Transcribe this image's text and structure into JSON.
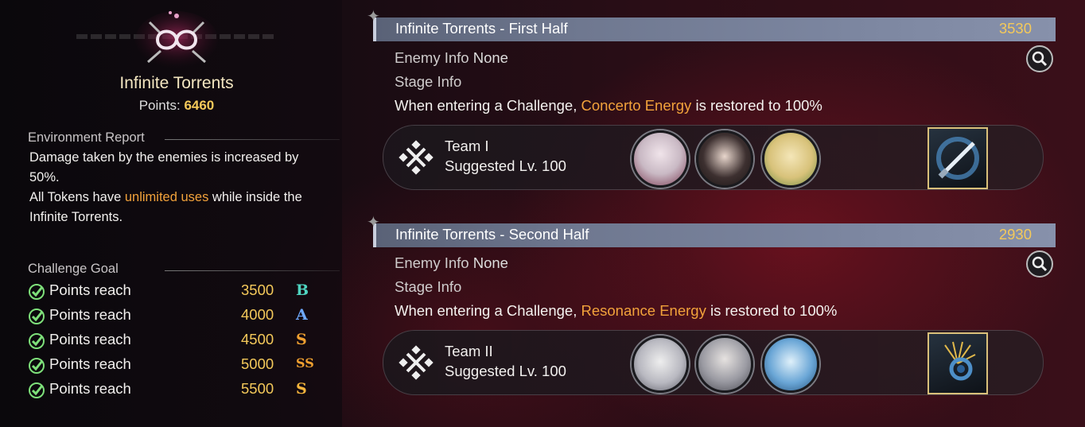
{
  "mode": {
    "title": "Infinite Torrents",
    "points_label": "Points:",
    "points_value": "6460"
  },
  "environment": {
    "heading": "Environment Report",
    "line1": "Damage taken by the enemies is increased by 50%.",
    "line2_pre": "All Tokens have ",
    "line2_highlight": "unlimited uses",
    "line2_post": " while inside the Infinite Torrents."
  },
  "challenge_goal": {
    "heading": "Challenge Goal",
    "goals": [
      {
        "label": "Points reach",
        "value": "3500",
        "grade": "B",
        "color": "#4fd4c0"
      },
      {
        "label": "Points reach",
        "value": "4000",
        "grade": "A",
        "color": "#6ea9ff"
      },
      {
        "label": "Points reach",
        "value": "4500",
        "grade": "S",
        "color": "#f0a030"
      },
      {
        "label": "Points reach",
        "value": "5000",
        "grade": "SS",
        "color": "#f0a030"
      },
      {
        "label": "Points reach",
        "value": "5500",
        "grade": "S",
        "color": "#f6b53c"
      }
    ]
  },
  "stages": [
    {
      "title": "Infinite Torrents - First Half",
      "points": "3530",
      "enemy_label": "Enemy Info",
      "enemy_value": "None",
      "stage_label": "Stage Info",
      "desc_pre": "When entering a Challenge, ",
      "desc_highlight": "Concerto Energy",
      "desc_post": " is restored to 100%",
      "team_name": "Team I",
      "team_level": "Suggested Lv. 100",
      "avatar_colors": [
        "#c9b9c4",
        "#3d3030",
        "#d8c27a"
      ]
    },
    {
      "title": "Infinite Torrents - Second Half",
      "points": "2930",
      "enemy_label": "Enemy Info",
      "enemy_value": "None",
      "stage_label": "Stage Info",
      "desc_pre": "When entering a Challenge, ",
      "desc_highlight": "Resonance Energy",
      "desc_post": " is restored to 100%",
      "team_name": "Team II",
      "team_level": "Suggested Lv. 100",
      "avatar_colors": [
        "#b8b8c0",
        "#9a9aa2",
        "#6aa6d6"
      ]
    }
  ],
  "colors": {
    "accent": "#f4c95a",
    "highlight": "#f2a23b",
    "check": "#7ee07a"
  }
}
